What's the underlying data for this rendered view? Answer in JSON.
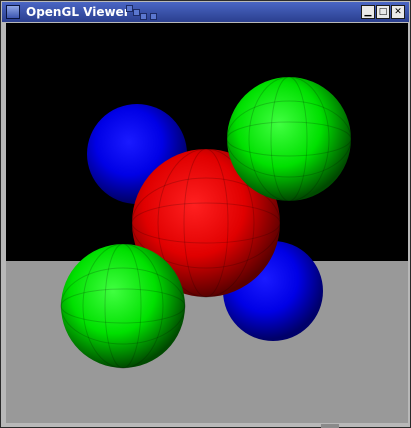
{
  "window": {
    "title": "OpenGL Viewer",
    "buttons": {
      "minimize": "▁",
      "maximize": "□",
      "close": "✕"
    }
  },
  "scene": {
    "background_color": "#000000",
    "floor_color": "#999999",
    "spheres": [
      {
        "name": "blue-sphere-back",
        "color": "blue"
      },
      {
        "name": "blue-sphere-front",
        "color": "blue"
      },
      {
        "name": "red-sphere",
        "color": "red"
      },
      {
        "name": "green-sphere-top",
        "color": "green"
      },
      {
        "name": "green-sphere-bottom",
        "color": "green"
      }
    ]
  },
  "colors": {
    "titlebar": "#3651a8",
    "red": "#ff0000",
    "green": "#00ff00",
    "blue": "#0000ff"
  }
}
